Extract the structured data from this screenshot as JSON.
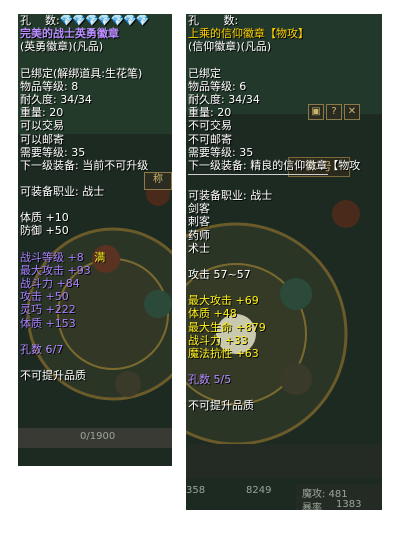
{
  "left": {
    "holes_label": "孔",
    "count_label": "数:",
    "gems": "💎💎💎💎💎💎💎",
    "name": "完美的战士英勇徽章",
    "subtype": "(英勇徽章)(凡品)",
    "bound": "已绑定(解绑道具:生花笔)",
    "item_level": "物品等级: 8",
    "durability": "耐久度: 34/34",
    "weight": "重量: 20",
    "tradable": "可以交易",
    "mailable": "可以邮寄",
    "req_level": "需要等级: 35",
    "next_equip": "下一级装备: 当前不可升级",
    "job": "可装备职业: 战士",
    "stat_1": "体质 +10",
    "stat_2": "防御 +50",
    "bonus_1": "战斗等级 +8",
    "bonus_1_tag": "满",
    "bonus_2": "最大攻击 +93",
    "bonus_3": "战斗力 +84",
    "bonus_4": "攻击 +50",
    "bonus_5": "灵巧 +222",
    "bonus_6": "体质 +153",
    "holes": "孔数 6/7",
    "no_upgrade": "不可提升品质",
    "title_btn": "称",
    "exp": "0/1900"
  },
  "right": {
    "holes_label": "孔",
    "count_label": "数:",
    "name": "上乘的信仰徽章【物攻】",
    "subtype": "(信仰徽章)(凡品)",
    "bound": "已绑定",
    "item_level": "物品等级: 6",
    "durability": "耐久度: 34/34",
    "weight": "重量: 20",
    "tradable": "不可交易",
    "mailable": "不可邮寄",
    "req_level": "需要等级: 35",
    "next_equip": "下一级装备: 精良的信仰徽章【物攻",
    "job": "可装备职业: 战士",
    "job_2": "剑客",
    "job_3": "刺客",
    "job_4": "药师",
    "job_5": "术士",
    "attack": "攻击 57~57",
    "bonus_1": "最大攻击 +69",
    "bonus_2": "体质 +48",
    "bonus_3": "最大生命 +879",
    "bonus_4": "战斗力 +33",
    "bonus_5": "魔法抗性 +63",
    "holes": "孔数 5/5",
    "no_upgrade": "不可提升品质",
    "title_btn": "称 号",
    "stat_a": "魔攻: 481",
    "stat_b": "8249",
    "stat_c": "358",
    "stat_d": "1383",
    "stat_e": "暴率"
  }
}
